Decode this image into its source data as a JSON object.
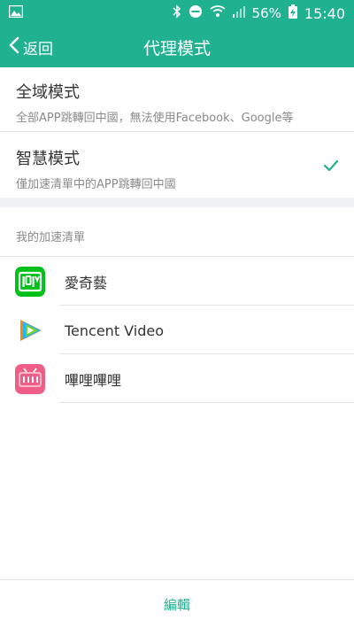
{
  "status": {
    "battery": "56%",
    "time": "15:40"
  },
  "header": {
    "back_label": "返回",
    "title": "代理模式"
  },
  "modes": [
    {
      "title": "全域模式",
      "description": "全部APP跳轉回中國，無法使用Facebook、Google等",
      "selected": false
    },
    {
      "title": "智慧模式",
      "description": "僅加速清單中的APP跳轉回中國",
      "selected": true
    }
  ],
  "accelerated_list": {
    "header": "我的加速清單",
    "items": [
      {
        "name": "愛奇藝",
        "icon": "iqiyi-icon"
      },
      {
        "name": "Tencent Video",
        "icon": "tencent-video-icon"
      },
      {
        "name": "嗶哩嗶哩",
        "icon": "bilibili-icon"
      }
    ]
  },
  "footer": {
    "edit_label": "編輯"
  },
  "colors": {
    "accent": "#20b190",
    "iqiyi": "#00c01a",
    "bilibili": "#ee5e86"
  }
}
